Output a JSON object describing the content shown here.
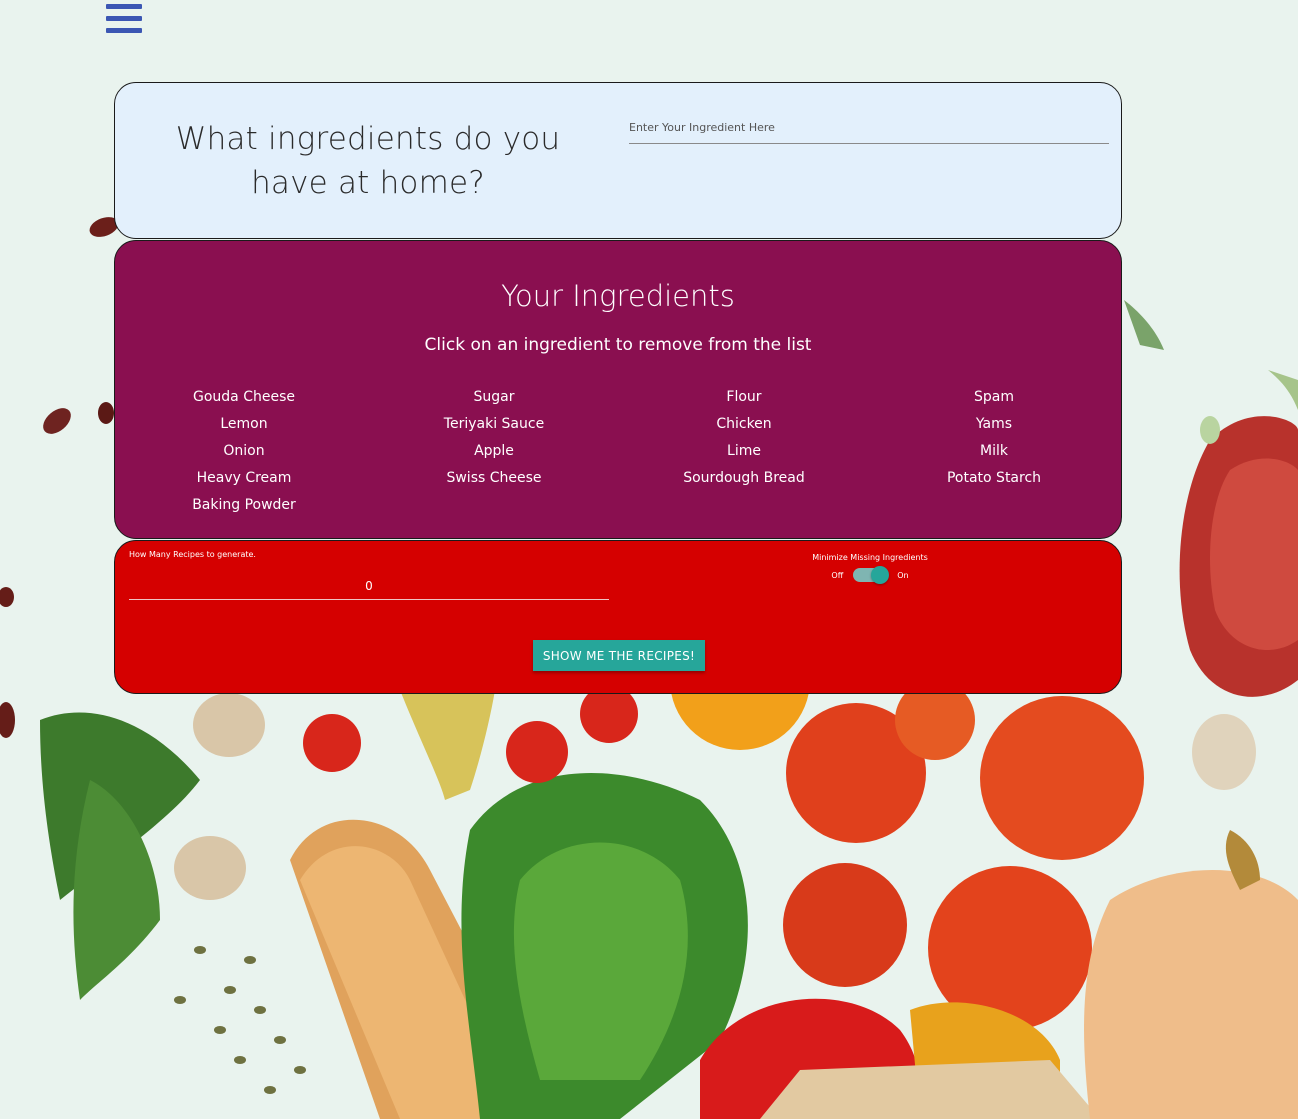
{
  "nav": {
    "menu_icon": "hamburger-menu-icon"
  },
  "search": {
    "question": "What ingredients do you have at home?",
    "placeholder": "Enter Your Ingredient Here",
    "value": ""
  },
  "ingredients": {
    "title": "Your Ingredients",
    "subtitle": "Click on an ingredient to remove from the list",
    "items": [
      "Gouda Cheese",
      "Sugar",
      "Flour",
      "Spam",
      "Lemon",
      "Teriyaki Sauce",
      "Chicken",
      "Yams",
      "Onion",
      "Apple",
      "Lime",
      "Milk",
      "Heavy Cream",
      "Swiss Cheese",
      "Sourdough Bread",
      "Potato Starch",
      "Baking Powder"
    ]
  },
  "generate": {
    "count_label": "How Many Recipes to generate.",
    "count_value": "0",
    "toggle_label": "Minimize Missing Ingredients",
    "toggle_off": "Off",
    "toggle_on": "On",
    "toggle_state": "on",
    "button_label": "SHOW ME THE RECIPES!"
  },
  "colors": {
    "menu": "#3b56b3",
    "search_card": "#e3f0fc",
    "ingredients_card": "#8a0f50",
    "generate_card": "#d50000",
    "accent": "#26a69a"
  },
  "background": {
    "scene": "groceries-photo"
  }
}
